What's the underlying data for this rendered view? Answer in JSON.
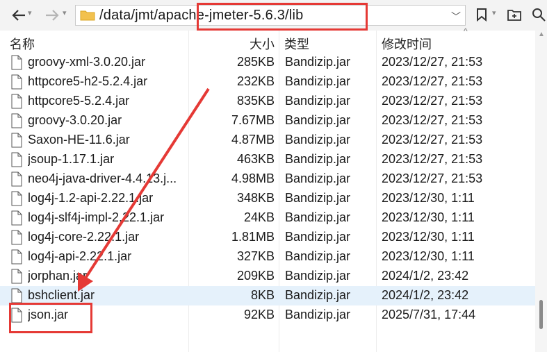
{
  "toolbar": {
    "back_icon": "back-arrow-icon",
    "forward_icon": "forward-arrow-icon",
    "address_path": "/data/jmt/apache-jmeter-5.6.3/lib"
  },
  "columns": {
    "name": "名称",
    "size": "大小",
    "type": "类型",
    "modified": "修改时间"
  },
  "files": [
    {
      "name": "groovy-xml-3.0.20.jar",
      "size": "285KB",
      "type": "Bandizip.jar",
      "modified": "2023/12/27, 21:53"
    },
    {
      "name": "httpcore5-h2-5.2.4.jar",
      "size": "232KB",
      "type": "Bandizip.jar",
      "modified": "2023/12/27, 21:53"
    },
    {
      "name": "httpcore5-5.2.4.jar",
      "size": "835KB",
      "type": "Bandizip.jar",
      "modified": "2023/12/27, 21:53"
    },
    {
      "name": "groovy-3.0.20.jar",
      "size": "7.67MB",
      "type": "Bandizip.jar",
      "modified": "2023/12/27, 21:53"
    },
    {
      "name": "Saxon-HE-11.6.jar",
      "size": "4.87MB",
      "type": "Bandizip.jar",
      "modified": "2023/12/27, 21:53"
    },
    {
      "name": "jsoup-1.17.1.jar",
      "size": "463KB",
      "type": "Bandizip.jar",
      "modified": "2023/12/27, 21:53"
    },
    {
      "name": "neo4j-java-driver-4.4.13.j...",
      "size": "4.98MB",
      "type": "Bandizip.jar",
      "modified": "2023/12/27, 21:53"
    },
    {
      "name": "log4j-1.2-api-2.22.1.jar",
      "size": "348KB",
      "type": "Bandizip.jar",
      "modified": "2023/12/30, 1:11"
    },
    {
      "name": "log4j-slf4j-impl-2.22.1.jar",
      "size": "24KB",
      "type": "Bandizip.jar",
      "modified": "2023/12/30, 1:11"
    },
    {
      "name": "log4j-core-2.22.1.jar",
      "size": "1.81MB",
      "type": "Bandizip.jar",
      "modified": "2023/12/30, 1:11"
    },
    {
      "name": "log4j-api-2.22.1.jar",
      "size": "327KB",
      "type": "Bandizip.jar",
      "modified": "2023/12/30, 1:11"
    },
    {
      "name": "jorphan.jar",
      "size": "209KB",
      "type": "Bandizip.jar",
      "modified": "2024/1/2, 23:42"
    },
    {
      "name": "bshclient.jar",
      "size": "8KB",
      "type": "Bandizip.jar",
      "modified": "2024/1/2, 23:42"
    },
    {
      "name": "json.jar",
      "size": "92KB",
      "type": "Bandizip.jar",
      "modified": "2025/7/31, 17:44"
    }
  ],
  "colors": {
    "highlight": "#e53935",
    "selected_row": "#e5f1fb"
  }
}
